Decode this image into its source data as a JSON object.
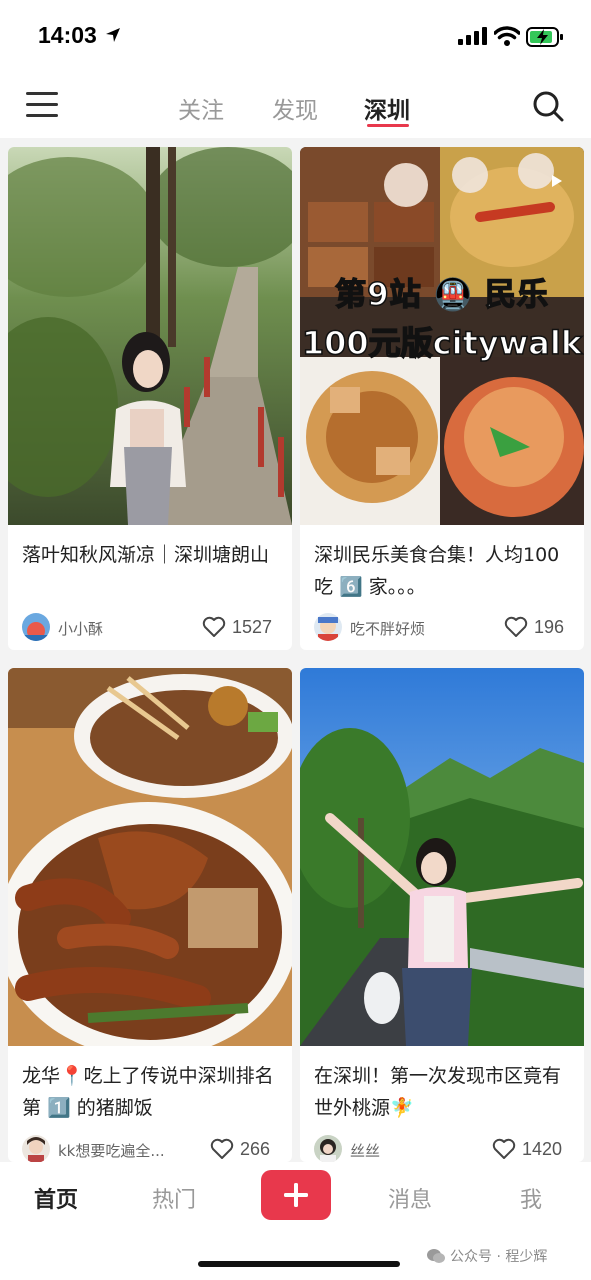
{
  "status": {
    "time": "14:03"
  },
  "nav": {
    "tabs": [
      {
        "label": "关注"
      },
      {
        "label": "发现"
      },
      {
        "label": "深圳",
        "active": true
      }
    ]
  },
  "feed": [
    {
      "title": "落叶知秋风渐凉｜深圳塘朗山",
      "author": "小小酥",
      "likes": "1527"
    },
    {
      "title": "深圳民乐美食合集！人均100吃 6️⃣ 家。。。",
      "author": "吃不胖好烦",
      "likes": "196",
      "image_text": [
        "第9站 🚇 民乐",
        "100元版citywalk"
      ]
    },
    {
      "title": "龙华📍吃上了传说中深圳排名第 1️⃣ 的猪脚饭",
      "author": "kk想要吃遍全...",
      "likes": "266"
    },
    {
      "title": "在深圳！第一次发现市区竟有世外桃源🧚",
      "author": "丝丝",
      "likes": "1420"
    }
  ],
  "bottom_nav": {
    "home": "首页",
    "hot": "热门",
    "post": "+",
    "messages": "消息",
    "me": "我"
  },
  "watermark": "公众号 · 程少辉",
  "colors": {
    "accent": "#e8384c",
    "background": "#f3f3f3",
    "card": "#ffffff",
    "battery": "#34c759"
  }
}
